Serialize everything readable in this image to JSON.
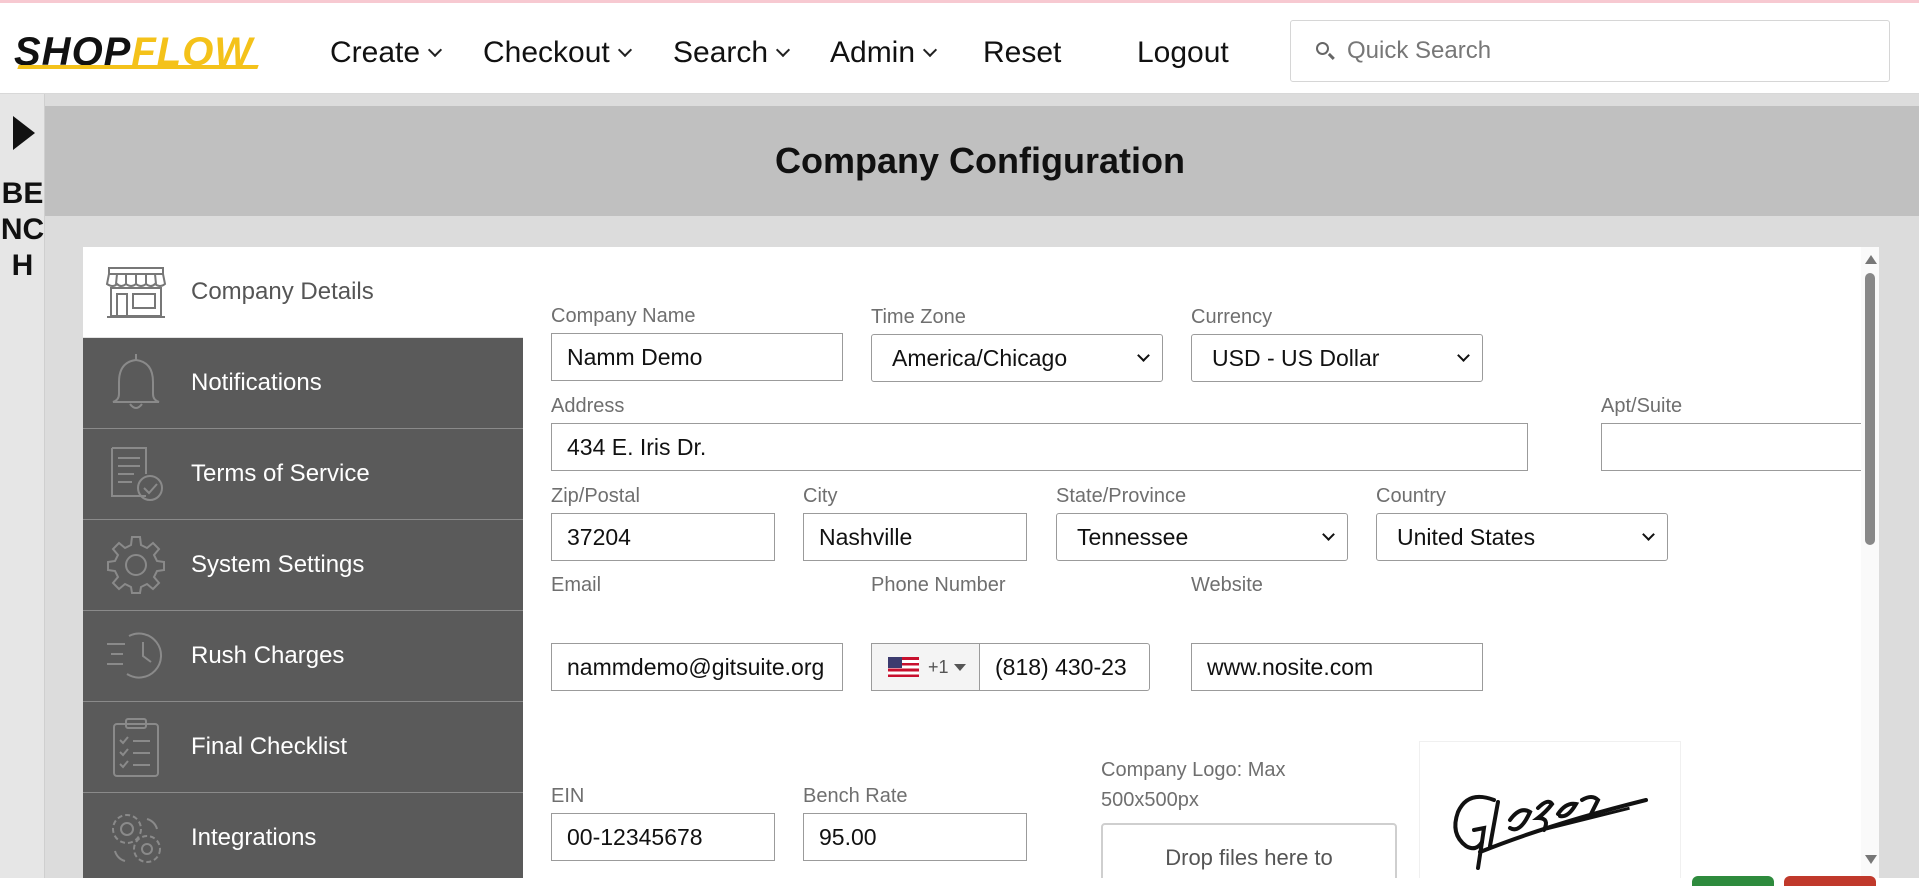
{
  "app": {
    "logo_part1": "SHOP",
    "logo_part2": "FLOW"
  },
  "nav": {
    "create": "Create",
    "checkout": "Checkout",
    "search": "Search",
    "admin": "Admin",
    "reset": "Reset",
    "logout": "Logout"
  },
  "quick_search": {
    "placeholder": "Quick Search"
  },
  "bench": {
    "label": "BENCH"
  },
  "page": {
    "title": "Company Configuration"
  },
  "sidebar": {
    "items": [
      {
        "label": "Company Details",
        "icon": "storefront-icon",
        "active": true
      },
      {
        "label": "Notifications",
        "icon": "bell-icon",
        "active": false
      },
      {
        "label": "Terms of Service",
        "icon": "document-check-icon",
        "active": false
      },
      {
        "label": "System Settings",
        "icon": "gear-icon",
        "active": false
      },
      {
        "label": "Rush Charges",
        "icon": "fast-clock-icon",
        "active": false
      },
      {
        "label": "Final Checklist",
        "icon": "clipboard-checklist-icon",
        "active": false
      },
      {
        "label": "Integrations",
        "icon": "gears-icon",
        "active": false
      }
    ]
  },
  "form": {
    "company_name": {
      "label": "Company Name",
      "value": "Namm Demo"
    },
    "time_zone": {
      "label": "Time Zone",
      "value": "America/Chicago"
    },
    "currency": {
      "label": "Currency",
      "value": "USD - US Dollar"
    },
    "address": {
      "label": "Address",
      "value": "434 E. Iris Dr."
    },
    "apt_suite": {
      "label": "Apt/Suite",
      "value": ""
    },
    "zip": {
      "label": "Zip/Postal",
      "value": "37204"
    },
    "city": {
      "label": "City",
      "value": "Nashville"
    },
    "state": {
      "label": "State/Province",
      "value": "Tennessee"
    },
    "country": {
      "label": "Country",
      "value": "United States"
    },
    "email": {
      "label": "Email",
      "value": "nammdemo@gitsuite.org"
    },
    "phone": {
      "label": "Phone Number",
      "dial_code": "+1",
      "value": "(818) 430-23"
    },
    "website": {
      "label": "Website",
      "value": "www.nosite.com"
    },
    "ein": {
      "label": "EIN",
      "value": "00-12345678"
    },
    "bench_rate": {
      "label": "Bench Rate",
      "value": "95.00"
    },
    "company_logo": {
      "label_line1": "Company Logo: Max",
      "label_line2": "500x500px",
      "dropzone_text": "Drop files here to"
    }
  },
  "colors": {
    "brand_yellow": "#f4c21a",
    "sidebar_bg": "#5a5a5a",
    "header_band": "#c0c0c0",
    "save_green": "#2e8b3d",
    "cancel_red": "#c0392b"
  }
}
